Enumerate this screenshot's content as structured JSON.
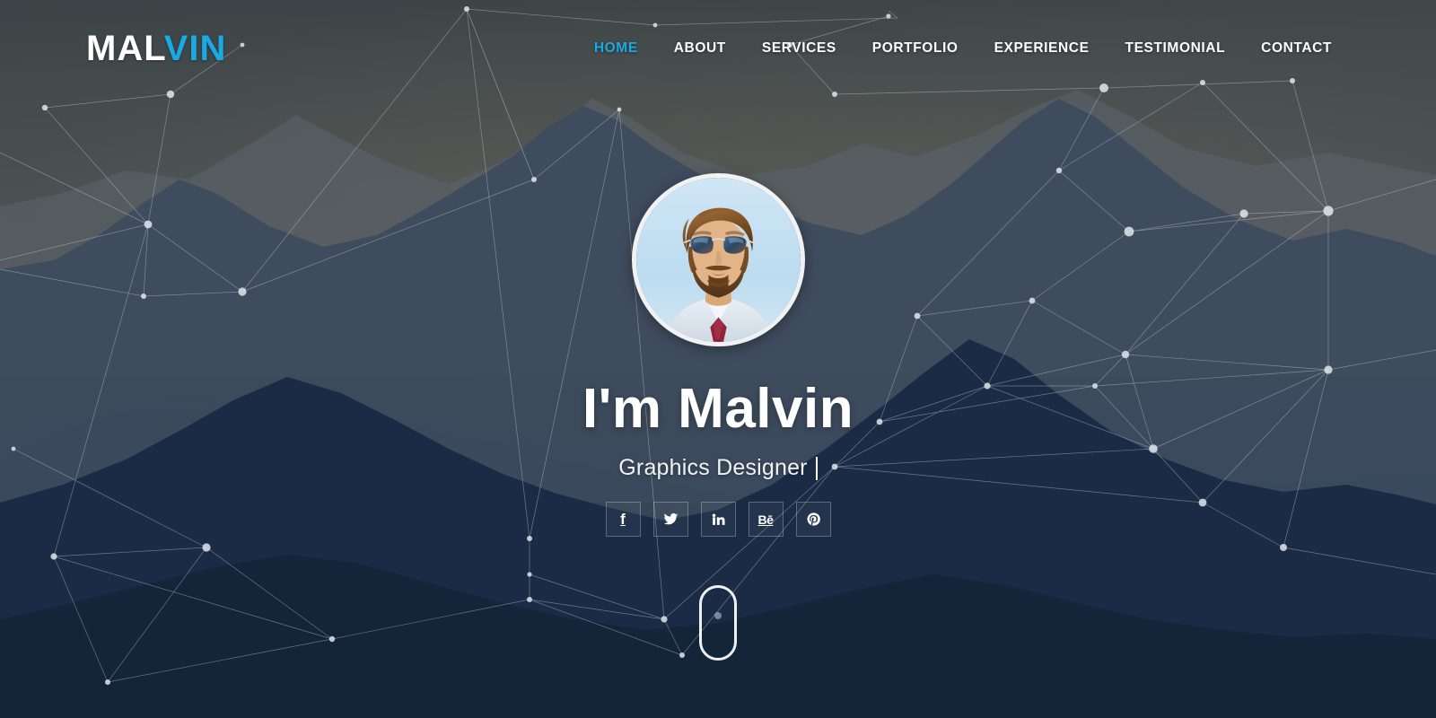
{
  "header": {
    "logo": {
      "part1": "MAL",
      "part2": "VIN",
      "accent_color": "#19a9e5"
    },
    "nav": [
      {
        "label": "HOME",
        "active": true,
        "name": "nav-item-home"
      },
      {
        "label": "ABOUT",
        "active": false,
        "name": "nav-item-about"
      },
      {
        "label": "SERVICES",
        "active": false,
        "name": "nav-item-services"
      },
      {
        "label": "PORTFOLIO",
        "active": false,
        "name": "nav-item-portfolio"
      },
      {
        "label": "EXPERIENCE",
        "active": false,
        "name": "nav-item-experience"
      },
      {
        "label": "TESTIMONIAL",
        "active": false,
        "name": "nav-item-testimonial"
      },
      {
        "label": "CONTACT",
        "active": false,
        "name": "nav-item-contact"
      }
    ]
  },
  "hero": {
    "avatar_alt": "profile-photo-bearded-man-with-sunglasses",
    "title": "I'm Malvin",
    "subtitle": "Graphics Designer",
    "typing_caret": "|",
    "social": [
      {
        "label": "Facebook",
        "icon": "facebook-icon"
      },
      {
        "label": "Twitter",
        "icon": "twitter-icon"
      },
      {
        "label": "LinkedIn",
        "icon": "linkedin-icon"
      },
      {
        "label": "Behance",
        "icon": "behance-icon"
      },
      {
        "label": "Pinterest",
        "icon": "pinterest-icon"
      }
    ],
    "scroll_indicator": "scroll-down-mouse-icon"
  },
  "theme": {
    "accent": "#19a9e5",
    "text_light": "#ffffff",
    "bg_sky_top": "#3c4346",
    "bg_mountain_near": "#16263d",
    "bg_mid": "#4b5152"
  }
}
